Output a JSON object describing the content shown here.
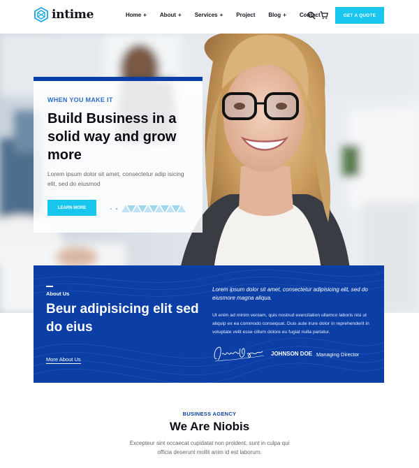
{
  "brand": {
    "name": "intime",
    "logo_icon": "hexagon-logo-icon",
    "accent": "#18c6ee",
    "primary": "#0b3fa5"
  },
  "nav": {
    "items": [
      {
        "label": "Home",
        "suffix": "+"
      },
      {
        "label": "About",
        "suffix": "+"
      },
      {
        "label": "Services",
        "suffix": "+"
      },
      {
        "label": "Project",
        "suffix": ""
      },
      {
        "label": "Blog",
        "suffix": "+"
      },
      {
        "label": "Contact",
        "suffix": ""
      }
    ],
    "search_icon": "search-icon",
    "cart_icon": "cart-icon",
    "cta_label": "GET A QUOTE"
  },
  "hero": {
    "eyebrow": "WHEN YOU MAKE IT",
    "title": "Build Business in a solid way and grow more",
    "description": "Lorem ipsum dolor sit amet, consectetur adip isicing elit, sed do eiusmod",
    "button_label": "LEARN MORE"
  },
  "about": {
    "label": "About Us",
    "title": "Beur adipisicing elit sed do eius",
    "link_label": "More About Us",
    "lead": "Lorem ipsum dolor sit amet, consectetur adipisicing elit, sed do eiusmore magna aliqua.",
    "body": "Ut enim ad minim veniam, quis nostrud exercitation ullamco laboris nisi ut aliquip ex ea commodo consequat. Duis aute irure dolor in reprehenderit in voluptate velit esse cillum dolore eu fugiat nulla pariatur.",
    "signature_text": "JohnsonDoe",
    "person_name": "JOHNSON DOE",
    "person_role": "Managing Director"
  },
  "agency": {
    "eyebrow": "BUSINESS AGENCY",
    "title": "We Are Niobis",
    "description": "Excepteur sint occaecat cupidatat non proident, sunt in culpa qui officia deserunt mollit anim id est laborum."
  }
}
